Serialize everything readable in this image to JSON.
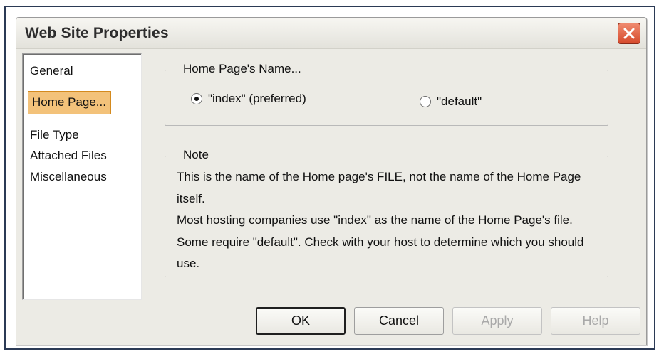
{
  "window": {
    "title": "Web Site Properties"
  },
  "nav": {
    "items": [
      {
        "label": "General"
      },
      {
        "label": "Home Page..."
      },
      {
        "label": "File Type"
      },
      {
        "label": "Attached Files"
      },
      {
        "label": "Miscellaneous"
      }
    ],
    "selected": "Home Page..."
  },
  "home_page_name": {
    "legend": "Home Page's Name...",
    "options": [
      {
        "label": "\"index\" (preferred)",
        "checked": true
      },
      {
        "label": "\"default\"",
        "checked": false
      }
    ]
  },
  "note": {
    "legend": "Note",
    "paragraphs": [
      "This is the name of the Home page's FILE, not the name of the Home Page itself.",
      "Most hosting companies use \"index\" as the name of the Home Page's file. Some require \"default\". Check with your host to determine which you should use."
    ]
  },
  "buttons": {
    "ok": "OK",
    "cancel": "Cancel",
    "apply": "Apply",
    "help": "Help"
  },
  "icons": {
    "close": "close-icon"
  },
  "colors": {
    "selected_nav_bg": "#f3c27a",
    "close_button": "#d64a2c"
  }
}
